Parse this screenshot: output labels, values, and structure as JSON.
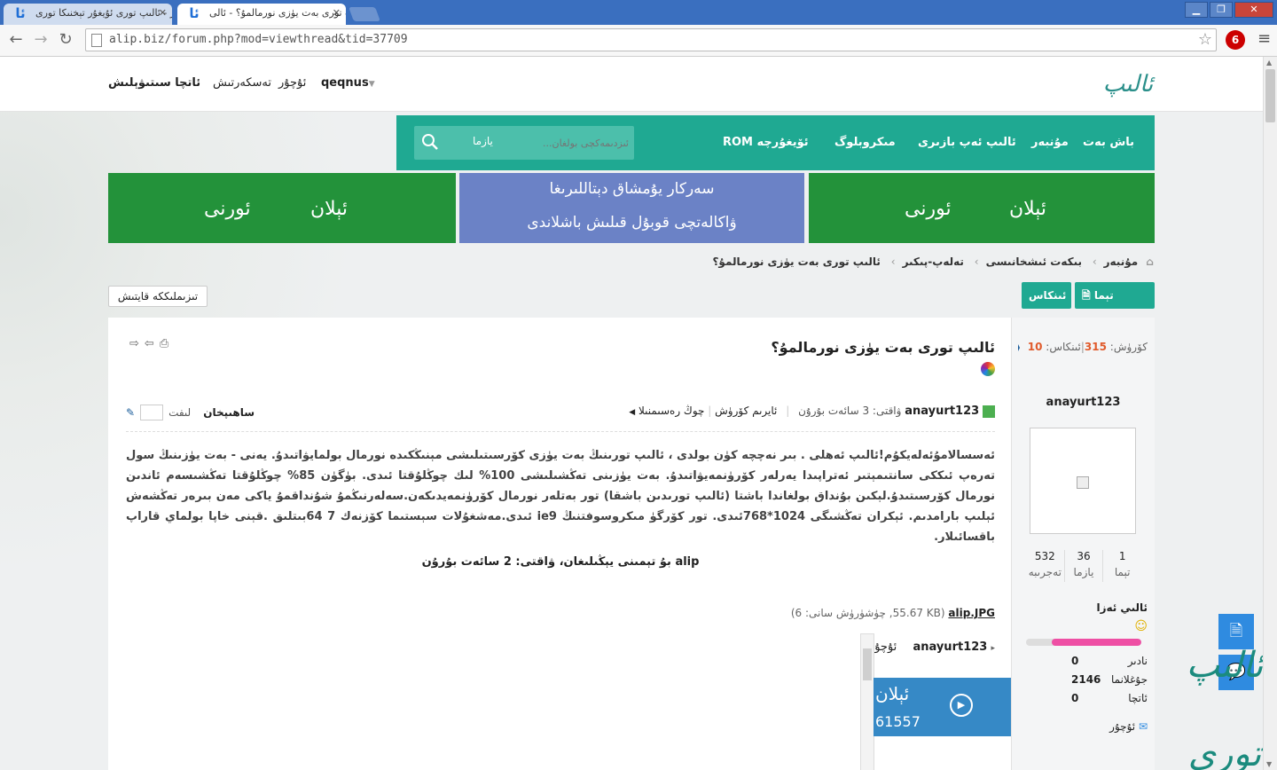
{
  "browser": {
    "tabs": [
      {
        "title": "مۇنبەر - ئالىپ تورى ئۇيغۇر تېخنىكا تورى",
        "favicon": "ئا"
      },
      {
        "title": "ئالىپ تورى بەت يۈزى نورمالمۇ؟ - ئالى",
        "favicon": "ئا"
      }
    ],
    "url": "alip.biz/forum.php?mod=viewthread&tid=37709",
    "window_buttons": {
      "min": "▁",
      "max": "❐",
      "close": "✕"
    },
    "back": "←",
    "forward": "→",
    "reload": "↻",
    "star": "☆",
    "menu": "≡",
    "ext_badge": "6"
  },
  "site": {
    "logo_text": "ئالىپ تورى",
    "top_links": {
      "user": "qeqnus",
      "message": "ئۇچۇر",
      "settings": "تەسكەرتىش",
      "logout": "ئاتچا سىتىۋېلىش"
    },
    "nav": {
      "home": "باش بەت",
      "forum": "مۇنبەر",
      "shop": "ئالىپ ئەپ بازىرى",
      "microblog": "مىكروبلوگ",
      "rom": "ROM ئۆيغۇرچە",
      "search_label": "يازما",
      "search_placeholder": "ئىزدىمەكچى بولغان..."
    },
    "banners": {
      "left_a": "ئېلان",
      "left_b": "ئورنى",
      "mid_line1": "سەركار يۇمشاق دېتاللىرىغا",
      "mid_line2": "ۋاكالەتچى قوبۇل قىلىش باشلاندى",
      "right_a": "ئېلان",
      "right_b": "ئورنى"
    }
  },
  "breadcrumb": {
    "home_icon": "⌂",
    "items": [
      "مۇنبەر",
      "بىكەت ئىشخانىسى",
      "تەلەپ-پىكىر",
      "ئالىپ تورى بەت يۈزى نورمالمۇ؟"
    ]
  },
  "actions": {
    "new_thread": "تېما يوللاش",
    "reply": "ئىنكاس",
    "back_list": "تىزىملىككە قايتىش"
  },
  "stats": {
    "views_label": "كۆرۈش:",
    "views": "315",
    "replies_label": "ئىنكاس:",
    "replies": "10"
  },
  "author": {
    "name": "anayurt123",
    "stats": [
      {
        "value": "1",
        "label": "تېما"
      },
      {
        "value": "36",
        "label": "يازما"
      },
      {
        "value": "532",
        "label": "تەجرىبە"
      }
    ],
    "rank": "ئالىي ئەزا",
    "progress_percent": 78,
    "details": [
      {
        "label": "نادىر",
        "value": "0"
      },
      {
        "label": "جۇغلانما",
        "value": "2146"
      },
      {
        "label": "ئاتچا",
        "value": "0"
      }
    ],
    "message_link": "ئۇچۇر"
  },
  "post": {
    "title": "ئالىپ تورى بەت يۈزى نورمالمۇ؟",
    "author": "anayurt123",
    "time_label": "ۋاقتى: 3 سائەت بۇرۇن",
    "only_author": "ئايرىم كۆرۈش",
    "reverse": "چوڭ رەسىمنىلا",
    "host_label": "ساھىپخان",
    "jump_label": "لىفت",
    "body": "ئەسسالامۇئەلەيكۇم!ئالىپ ئەھلى . بىر نەچچە كۈن بولدى ، ئالىپ تورىنىڭ بەت يۈزى كۆرسىتىلىشى مېنىڭكىدە نورمال بولمايۋاتىدۇ. يەنى - بەت يۈزىنىڭ سول تەرەپ ئىككى سانتىمېتىر ئەتراپىدا يەرلەر كۆرۈنمەيۋاتىدۇ. بەت يۈزىنى تەڭشىلىشى 100% لىك چوڭلۇقتا ئىدى. بۈگۈن 85% چوڭلۇقتا تەڭشىسەم ئاندىن نورمال كۆرسىتىدۇ.لېكىن بۇنداق بولغاندا باشتا (ئالىپ تورىدىن باشقا) تور بەتلەر نورمال كۆرۈنمەيدىكەن.سەلەرنىڭمۇ شۇنداقمۇ ياكى مەن بىرەر تەڭشەش ئېلىپ بارامدىم. ئېكران تەڭشىگى 1024*768ئىدى. تور كۆرگۈ مىكروسوفتنىڭ ie9 ئىدى.مەشغۇلات سېستىما كۆزنەك 7 64بىتلىق .قېنى خاپا بولماي قاراپ باقسائىلار.",
    "edit_note": "alip بۇ تېمىنى يېڭىلىغان، ۋاقتى: 2 سائەت بۇرۇن",
    "attachment": {
      "name": "alip.JPG",
      "meta": "(55.67 KB, چۈشۈرۈش سانى: 6)"
    },
    "popup": {
      "user": "anayurt123",
      "message": "ئۇچۇر",
      "ad_line1": "ئېلان",
      "ad_line2": "61557"
    }
  },
  "float": {
    "doc_icon": "🗎",
    "chat_icon": "💬",
    "watermark": "ئالىپ تورى"
  }
}
